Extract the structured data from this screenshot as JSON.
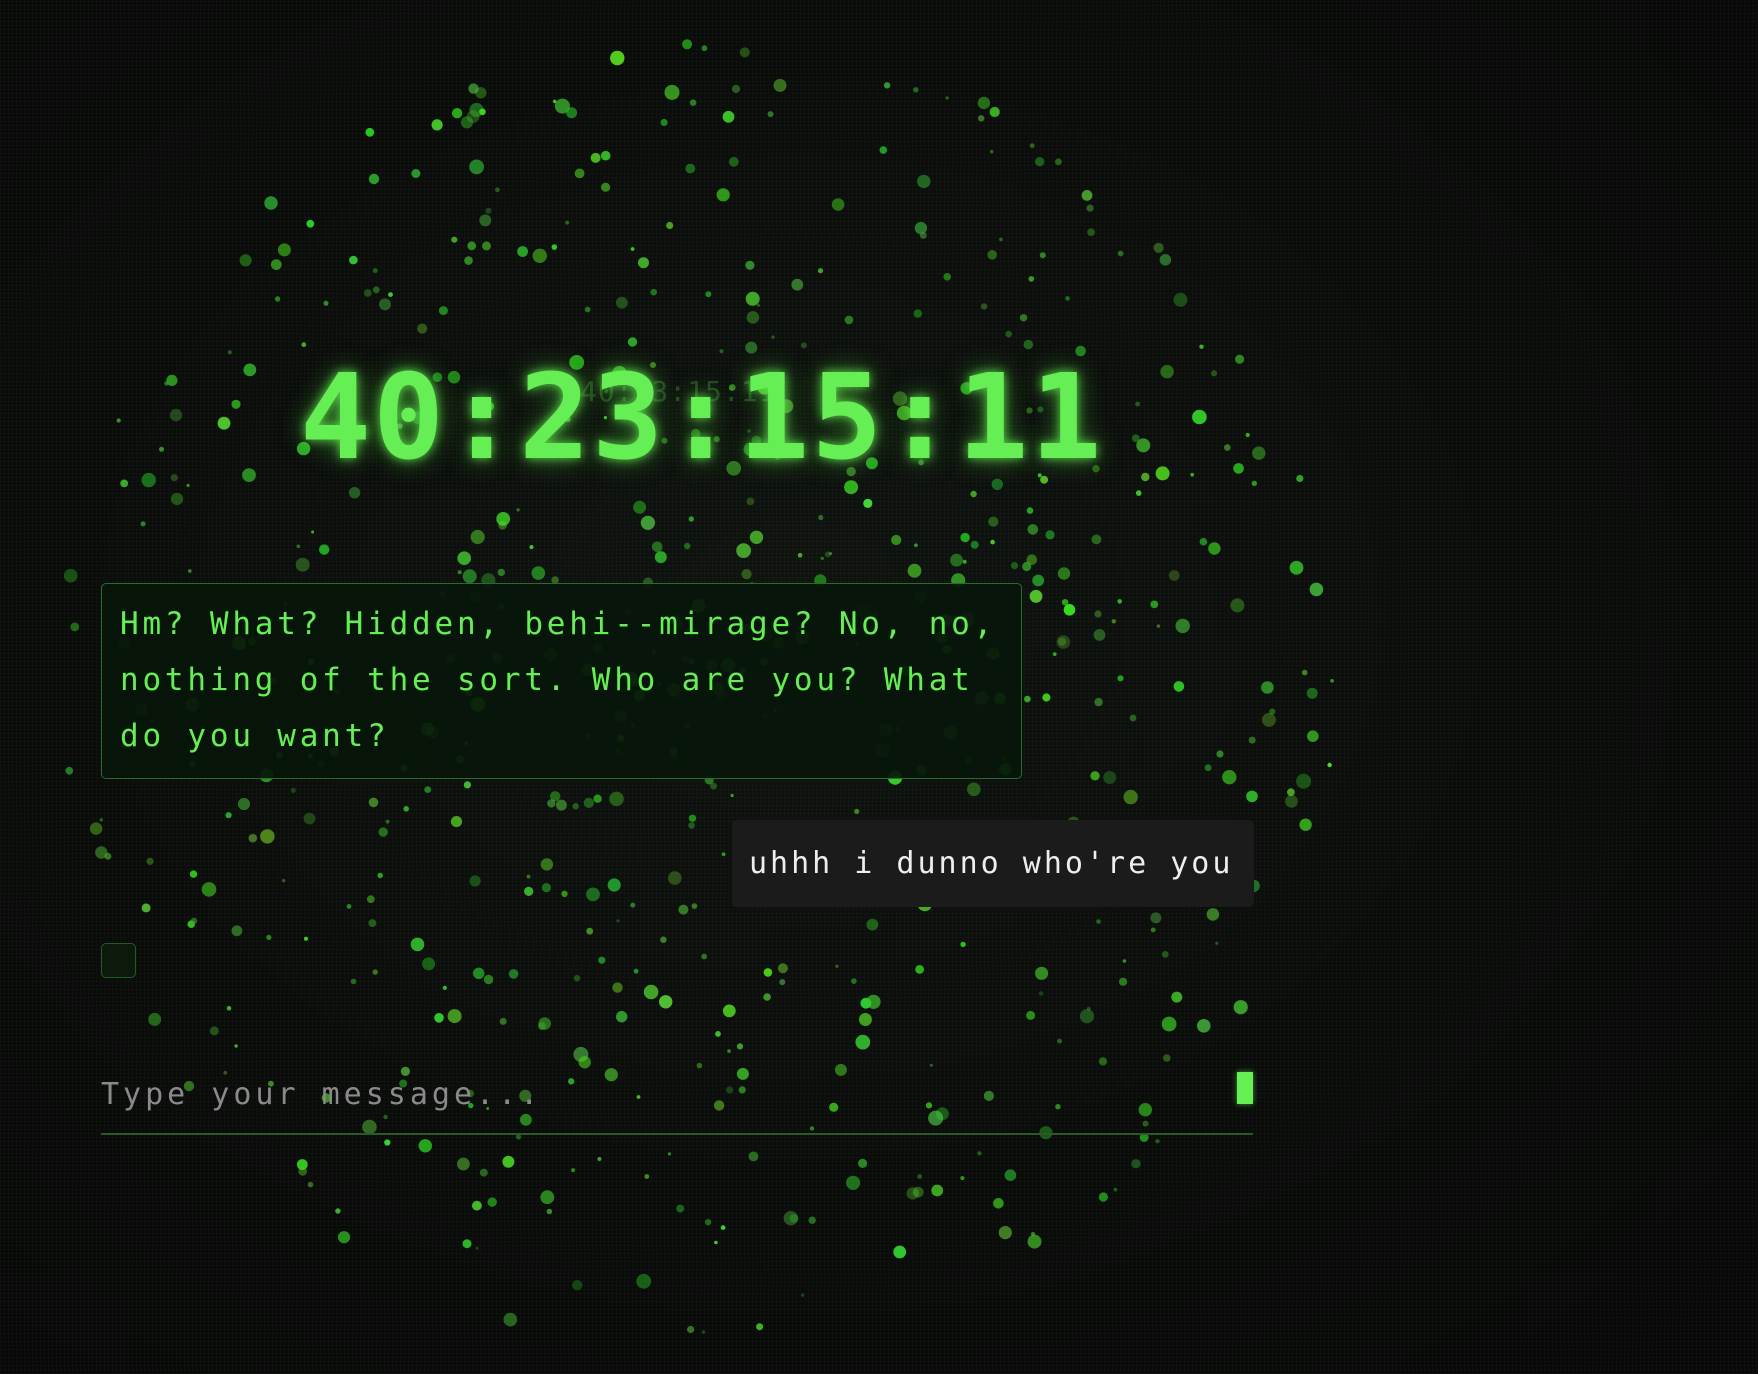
{
  "countdown": {
    "value": "40:23:15:11",
    "ghost_value": "40:23:15:11"
  },
  "messages": [
    {
      "role": "bot",
      "text": "Hm? What? Hidden, behi--mirage? No, no, nothing of the sort. Who are you? What do you want?"
    },
    {
      "role": "user",
      "text": "uhhh i dunno who're you"
    }
  ],
  "composer": {
    "placeholder": "Type your message...",
    "value": ""
  },
  "colors": {
    "accent": "#66ee55",
    "background": "#0a0c0a",
    "user_bubble": "#1b1b1b",
    "bot_bubble_border": "#2b6b2b"
  }
}
